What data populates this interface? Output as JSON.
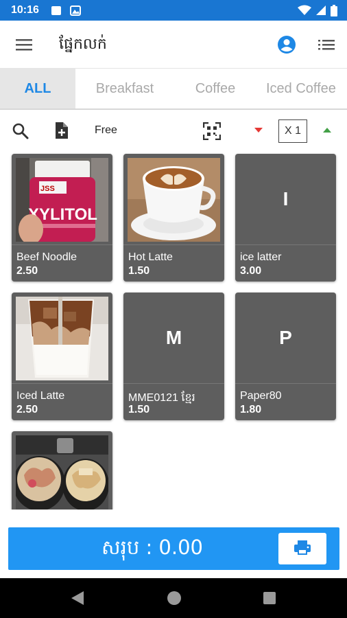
{
  "status_bar": {
    "time": "10:16"
  },
  "app_bar": {
    "title": "ផ្នែកលក់"
  },
  "tabs": [
    {
      "label": "ALL",
      "active": true
    },
    {
      "label": "Breakfast",
      "active": false
    },
    {
      "label": "Coffee",
      "active": false
    },
    {
      "label": "Iced Coffee",
      "active": false
    }
  ],
  "toolbar": {
    "free_label": "Free",
    "quantity": "X 1",
    "icons": [
      "search-icon",
      "add-file-icon",
      "qr-scan-icon",
      "decrease-icon",
      "increase-icon"
    ]
  },
  "products": [
    {
      "name": "Beef Noodle",
      "price": "2.50",
      "image": "xylitol-jar"
    },
    {
      "name": "Hot Latte",
      "price": "1.50",
      "image": "latte-art-cup"
    },
    {
      "name": "ice latter",
      "price": "3.00",
      "initial": "I"
    },
    {
      "name": "Iced Latte",
      "price": "2.50",
      "image": "iced-latte-glass"
    },
    {
      "name": "MME0121 ខ្មែរ",
      "price": "1.50",
      "initial": "M"
    },
    {
      "name": "Paper80",
      "price": "1.80",
      "initial": "P"
    },
    {
      "name": "",
      "price": "",
      "image": "noodle-bowls"
    }
  ],
  "total": {
    "label": "សរុប : 0.00"
  },
  "colors": {
    "primary": "#1976d2",
    "accent": "#2196f3",
    "card": "#5e5e5e",
    "tab_active": "#1e88e5",
    "down_arrow": "#e53935",
    "up_arrow": "#43a047"
  }
}
